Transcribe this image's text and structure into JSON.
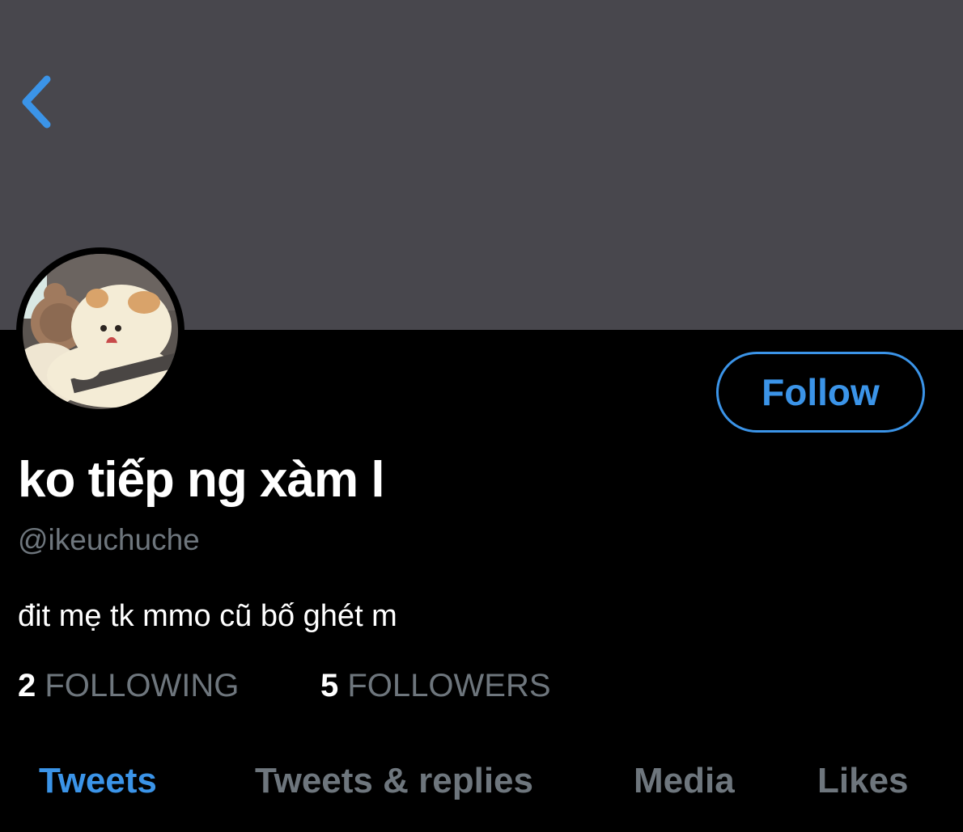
{
  "header": {
    "back_icon": "chevron-left-icon",
    "accent_color": "#3b94e8",
    "banner_color": "#48474d"
  },
  "profile": {
    "display_name": "ko tiếp ng xàm l",
    "handle": "@ikeuchuche",
    "bio": "đit mẹ tk mmo cũ bố ghét m",
    "follow_label": "Follow"
  },
  "stats": {
    "following_count": "2",
    "following_label": "FOLLOWING",
    "followers_count": "5",
    "followers_label": "FOLLOWERS"
  },
  "tabs": [
    {
      "label": "Tweets",
      "active": true
    },
    {
      "label": "Tweets & replies",
      "active": false
    },
    {
      "label": "Media",
      "active": false
    },
    {
      "label": "Likes",
      "active": false
    }
  ]
}
